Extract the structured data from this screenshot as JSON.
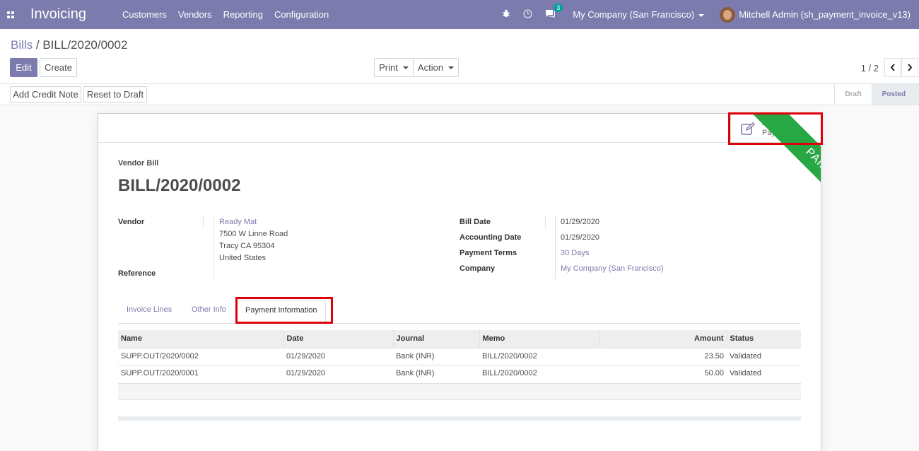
{
  "navbar": {
    "app_name": "Invoicing",
    "menu": [
      "Customers",
      "Vendors",
      "Reporting",
      "Configuration"
    ],
    "message_count": "3",
    "company": "My Company (San Francisco)",
    "user": "Mitchell Admin (sh_payment_invoice_v13)"
  },
  "breadcrumb": {
    "parent": "Bills",
    "separator": " / ",
    "current": "BILL/2020/0002"
  },
  "buttons": {
    "edit": "Edit",
    "create": "Create",
    "print": "Print",
    "action": "Action",
    "add_credit_note": "Add Credit Note",
    "reset_to_draft": "Reset to Draft"
  },
  "pager": {
    "value": "1 / 2"
  },
  "statusbar": {
    "stages": [
      "Draft",
      "Posted"
    ],
    "active": "Posted"
  },
  "smart_button": {
    "count": "2",
    "label": "Payments"
  },
  "ribbon": {
    "text": "PAID"
  },
  "form": {
    "type_label": "Vendor Bill",
    "name": "BILL/2020/0002",
    "vendor_label": "Vendor",
    "vendor_name": "Ready Mat",
    "vendor_street": "7500 W Linne Road",
    "vendor_city": "Tracy CA 95304",
    "vendor_country": "United States",
    "reference_label": "Reference",
    "bill_date_label": "Bill Date",
    "bill_date": "01/29/2020",
    "accounting_date_label": "Accounting Date",
    "accounting_date": "01/29/2020",
    "payment_terms_label": "Payment Terms",
    "payment_terms": "30 Days",
    "company_label": "Company",
    "company": "My Company (San Francisco)"
  },
  "tabs": [
    "Invoice Lines",
    "Other Info",
    "Payment Information"
  ],
  "active_tab": "Payment Information",
  "payments_table": {
    "columns": [
      "Name",
      "Date",
      "Journal",
      "Memo",
      "Amount",
      "Status"
    ],
    "rows": [
      [
        "SUPP.OUT/2020/0002",
        "01/29/2020",
        "Bank (INR)",
        "BILL/2020/0002",
        "23.50",
        "Validated"
      ],
      [
        "SUPP.OUT/2020/0001",
        "01/29/2020",
        "Bank (INR)",
        "BILL/2020/0002",
        "50.00",
        "Validated"
      ]
    ]
  },
  "colors": {
    "brand": "#7c7bad",
    "paid_ribbon": "#28a745",
    "highlight": "#e0000a"
  }
}
